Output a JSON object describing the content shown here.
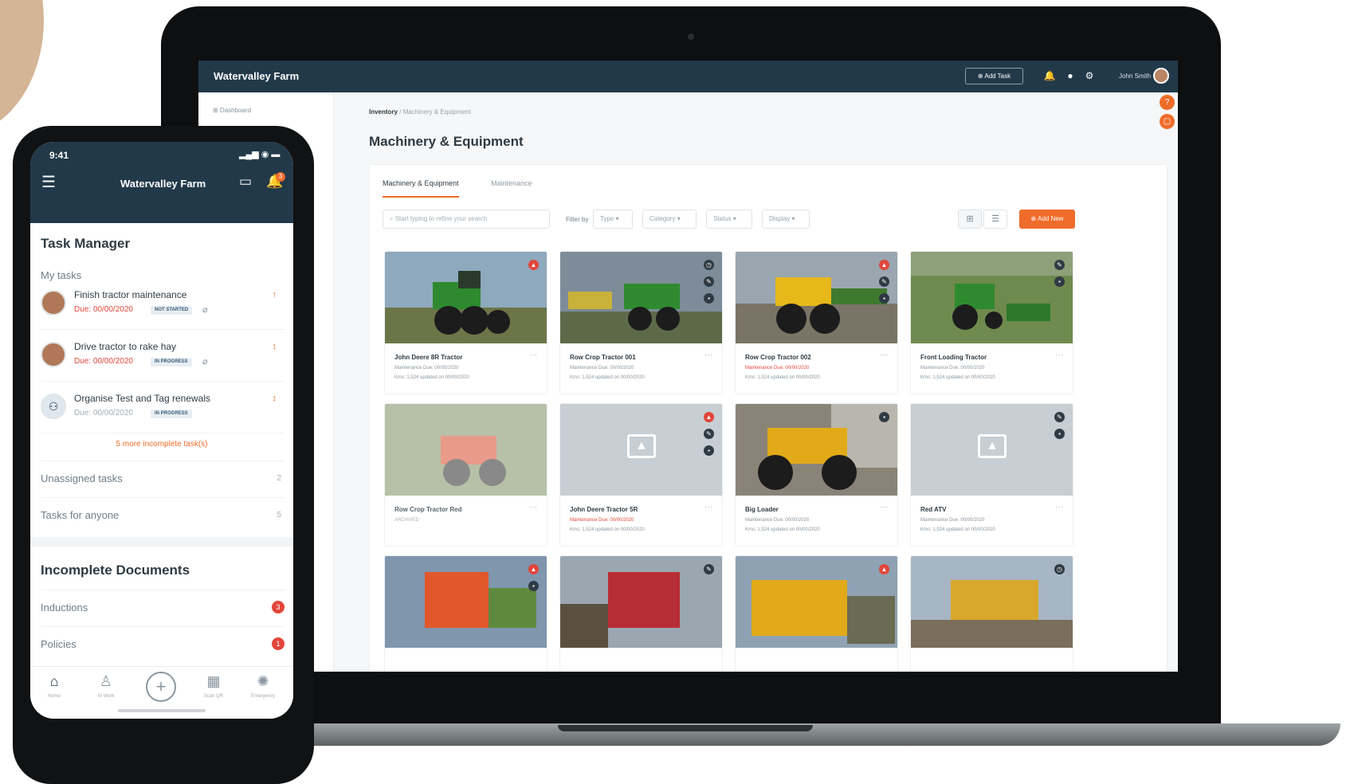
{
  "laptop": {
    "app_name": "Watervalley Farm",
    "add_task_label": "⊕ Add Task",
    "user_name": "John Smith",
    "sidebar_item": "⊞  Dashboard",
    "breadcrumb_root": "Inventory",
    "breadcrumb_sep": "/",
    "breadcrumb_current": "Machinery & Equipment",
    "page_title": "Machinery & Equipment",
    "tabs": [
      "Machinery & Equipment",
      "Maintenance"
    ],
    "search_placeholder": "Start typing to refine your search",
    "filter_label": "Filter by",
    "filters": [
      "Type",
      "Category",
      "Status",
      "Display"
    ],
    "add_new_label": "⊕ Add New",
    "cards": [
      {
        "title": "John Deere 8R Tractor",
        "line1": "Maintenance Due: 00/00/2020",
        "line2": "Kms: 1,524 updated on 00/00/2020",
        "overdue": false
      },
      {
        "title": "Row Crop Tractor 001",
        "line1": "Maintenance Due: 00/00/2020",
        "line2": "Kms: 1,524 updated on 00/00/2020",
        "overdue": false
      },
      {
        "title": "Row Crop Tractor 002",
        "line1": "Maintenance Due: 00/00/2020",
        "line2": "Kms: 1,524 updated on 00/00/2020",
        "overdue": true
      },
      {
        "title": "Front Loading Tractor",
        "line1": "Maintenance Due: 00/00/2020",
        "line2": "Kms: 1,524 updated on 00/00/2020",
        "overdue": false
      },
      {
        "title": "Row Crop Tractor Red",
        "line1": "ARCHIVED",
        "line2": "",
        "overdue": false
      },
      {
        "title": "John Deere Tractor 5R",
        "line1": "Maintenance Due: 00/00/2020",
        "line2": "Kms: 1,524 updated on 00/00/2020",
        "overdue": true
      },
      {
        "title": "Big Loader",
        "line1": "Maintenance Due: 00/00/2020",
        "line2": "Kms: 1,524 updated on 00/00/2020",
        "overdue": false
      },
      {
        "title": "Red ATV",
        "line1": "Maintenance Due: 00/00/2020",
        "line2": "Kms: 1,524 updated on 00/00/2020",
        "overdue": false
      }
    ]
  },
  "phone": {
    "time": "9:41",
    "status_icons": "▂▄▆ ◉ ▬",
    "app_name": "Watervalley Farm",
    "task_manager_title": "Task Manager",
    "my_tasks_label": "My tasks",
    "tasks": [
      {
        "title": "Finish tractor maintenance",
        "due": "Due: 00/00/2020",
        "badge": "NOT STARTED",
        "overdue": true
      },
      {
        "title": "Drive tractor to rake hay",
        "due": "Due: 00/00/2020",
        "badge": "IN PROGRESS",
        "overdue": true
      },
      {
        "title": "Organise Test and Tag renewals",
        "due": "Due: 00/00/2020",
        "badge": "IN PROGRESS",
        "overdue": false
      }
    ],
    "more_incomplete": "5 more incomplete task(s)",
    "unassigned_label": "Unassigned tasks",
    "unassigned_count": "2",
    "anyone_label": "Tasks for anyone",
    "anyone_count": "5",
    "documents_title": "Incomplete Documents",
    "inductions_label": "Inductions",
    "inductions_count": "3",
    "policies_label": "Policies",
    "policies_count": "1",
    "tabbar": [
      "Home",
      "At Work",
      "Scan QR",
      "Emergency"
    ]
  },
  "colors": {
    "navy": "#22394a",
    "orange": "#ef6c2a",
    "red": "#e2463a"
  }
}
